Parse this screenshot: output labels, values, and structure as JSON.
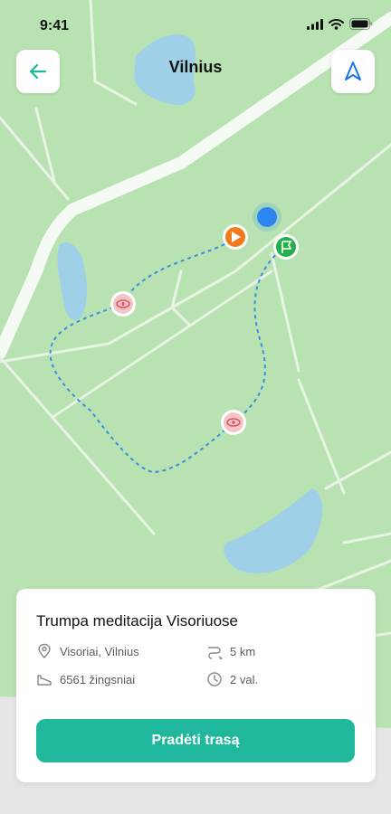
{
  "status_bar": {
    "time": "9:41",
    "icons": [
      "signal-icon",
      "wifi-icon",
      "battery-icon"
    ]
  },
  "header": {
    "title": "Vilnius",
    "back_icon": "arrow-left-icon",
    "navigate_icon": "navigation-arrow-icon"
  },
  "map": {
    "markers": [
      "current-location-marker",
      "start-marker",
      "finish-marker",
      "viewpoint-marker",
      "viewpoint-marker"
    ],
    "colors": {
      "land": "#b9e2b2",
      "road": "#eef5ec",
      "water": "#9fd0e8",
      "route": "#3b8de0",
      "start": "#f07a1d",
      "finish": "#27b04a",
      "viewpoint": "#f2c6c8",
      "location": "#2d86f0"
    }
  },
  "route_card": {
    "title": "Trumpa meditacija Visoriuose",
    "location": "Visoriai, Vilnius",
    "distance": "5 km",
    "steps": "6561 žingsniai",
    "duration": "2 val.",
    "start_button_label": "Pradėti trasą"
  },
  "colors": {
    "accent": "#1fb89d",
    "icon_accent": "#1a73e8"
  }
}
